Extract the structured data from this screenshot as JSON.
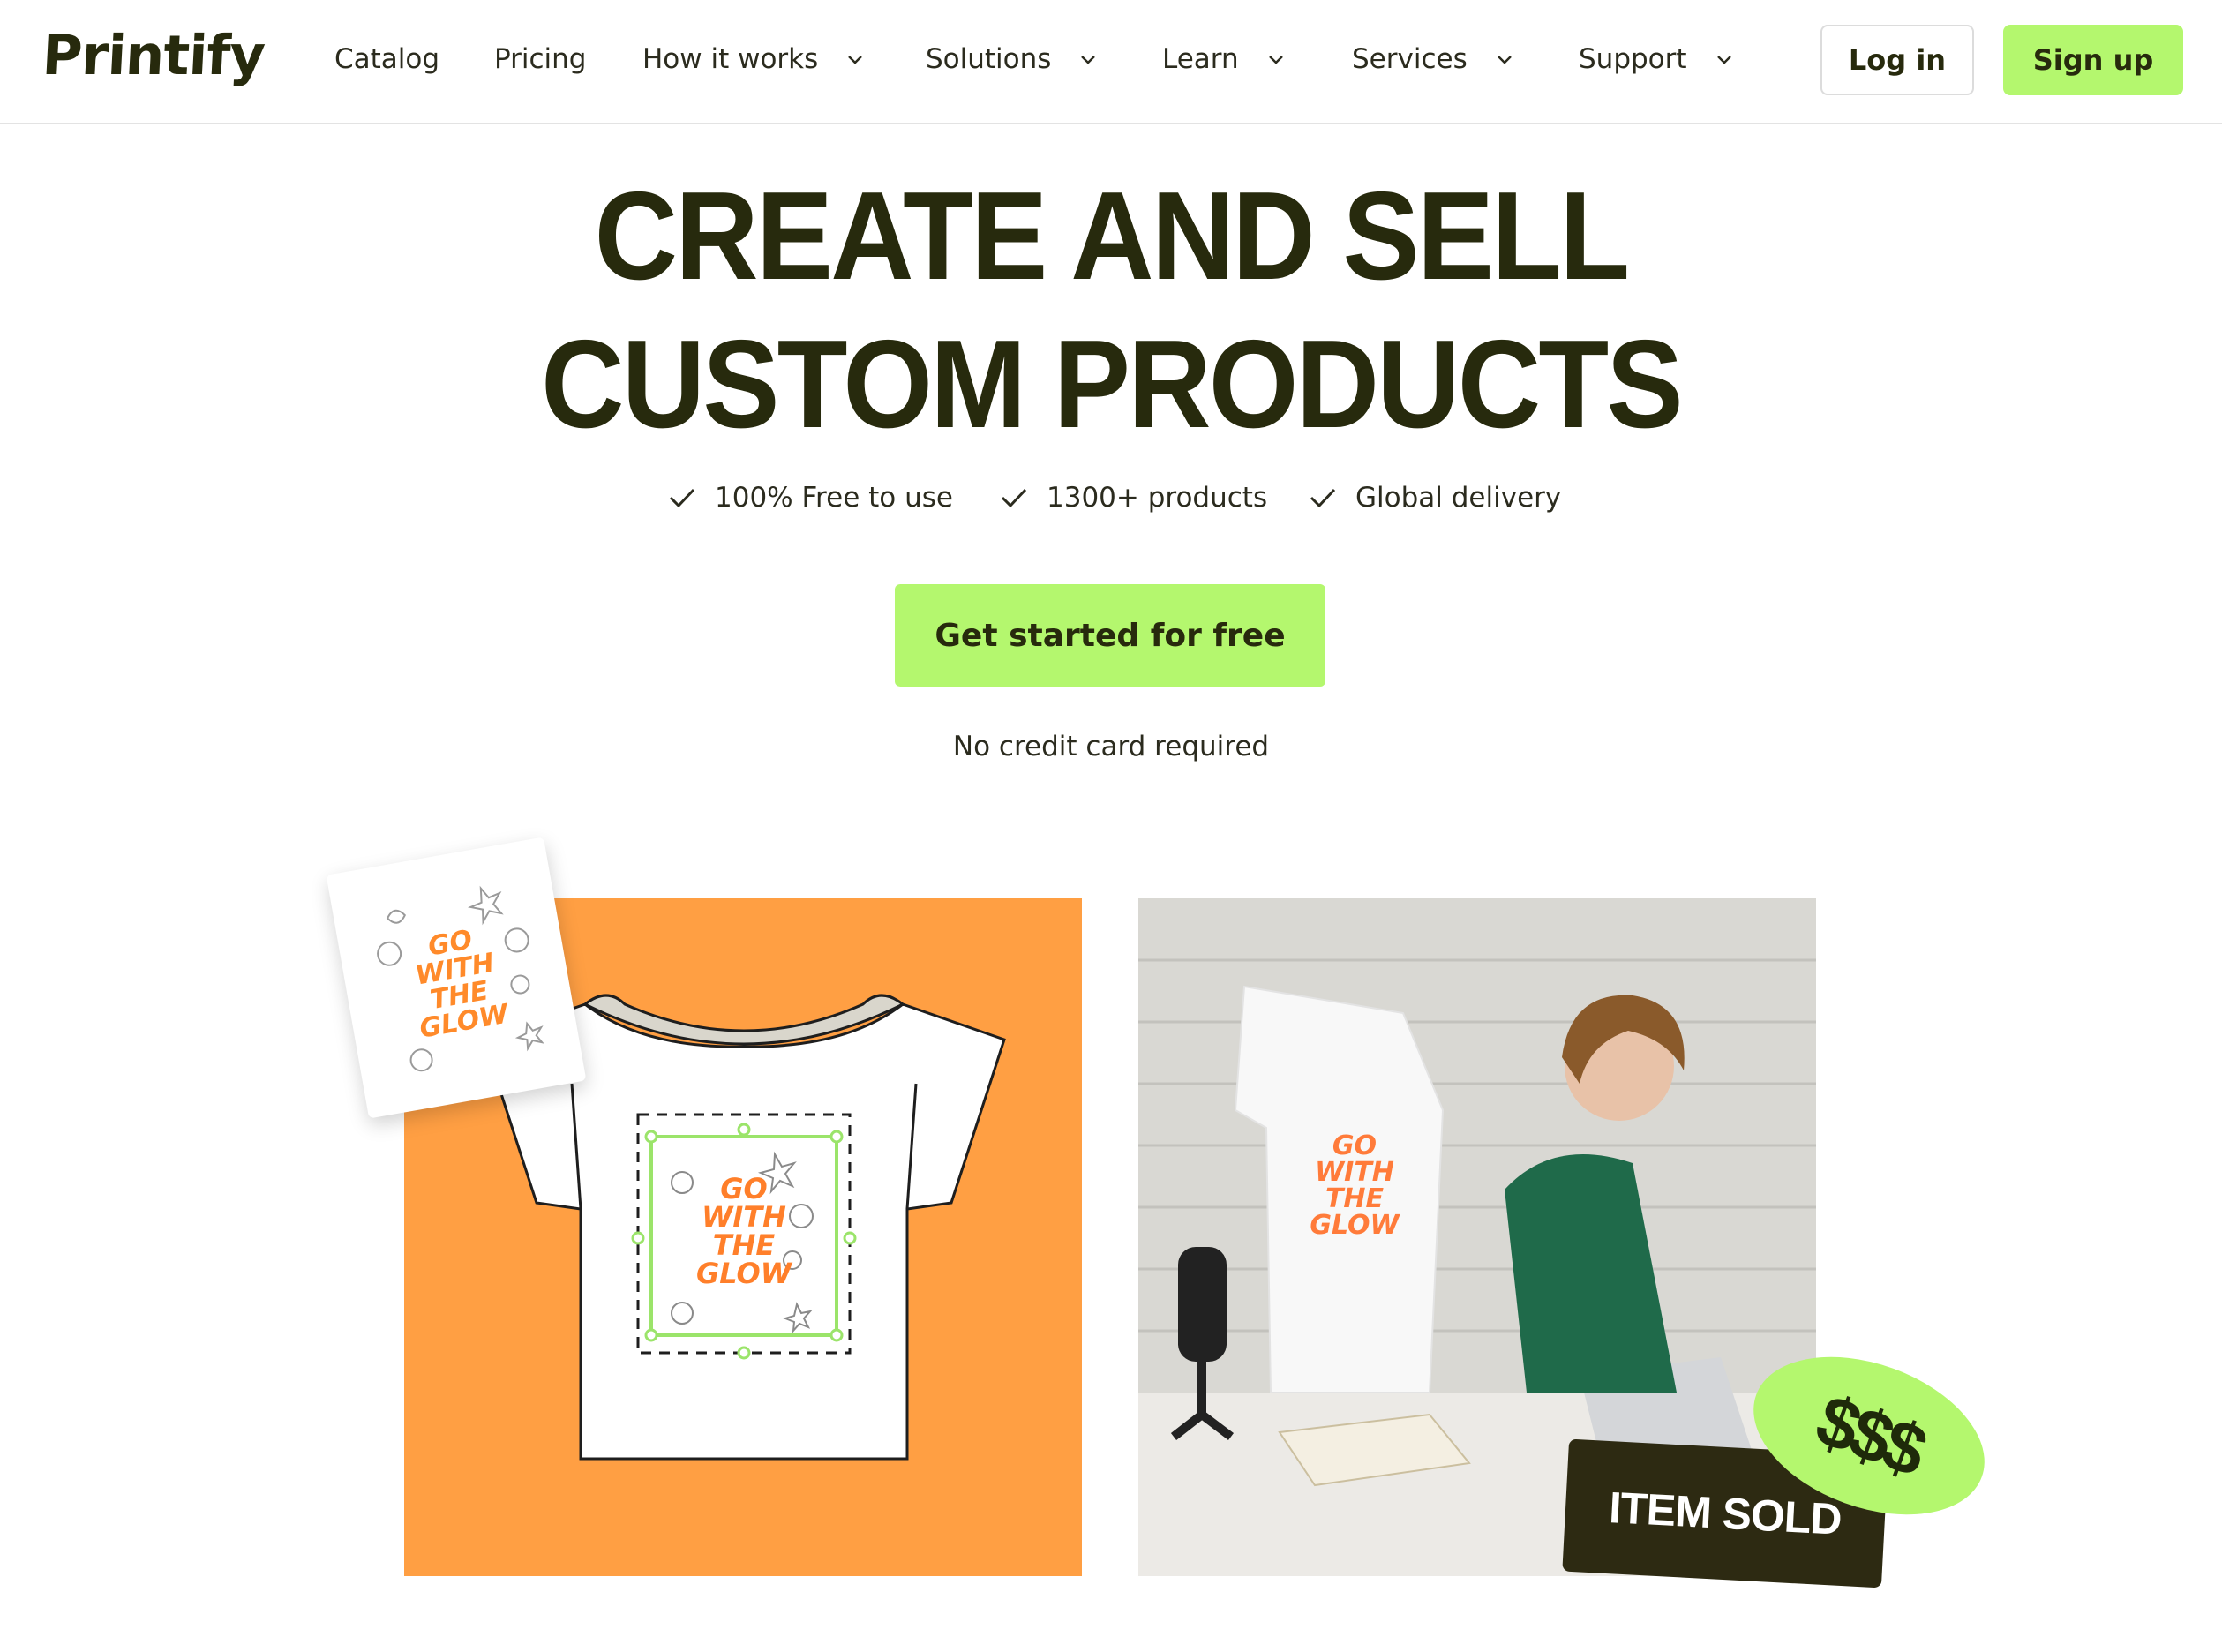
{
  "header": {
    "logo": "Printify",
    "nav": [
      {
        "label": "Catalog",
        "dropdown": false
      },
      {
        "label": "Pricing",
        "dropdown": false
      },
      {
        "label": "How it works",
        "dropdown": true
      },
      {
        "label": "Solutions",
        "dropdown": true
      },
      {
        "label": "Learn",
        "dropdown": true
      },
      {
        "label": "Services",
        "dropdown": true
      },
      {
        "label": "Support",
        "dropdown": true
      }
    ],
    "login_label": "Log in",
    "signup_label": "Sign up"
  },
  "hero": {
    "title_line1": "CREATE AND SELL",
    "title_line2": "CUSTOM PRODUCTS",
    "features": [
      "100% Free to use",
      "1300+ products",
      "Global delivery"
    ],
    "cta_label": "Get started for free",
    "note": "No credit card required"
  },
  "images": {
    "design_text": [
      "GO",
      "WITH",
      "THE",
      "GLOW"
    ],
    "sold_label": "ITEM SOLD",
    "money_label": "$$$"
  },
  "colors": {
    "accent_green": "#b4f76e",
    "dark_olive": "#272a0d",
    "orange": "#ff9f43"
  }
}
